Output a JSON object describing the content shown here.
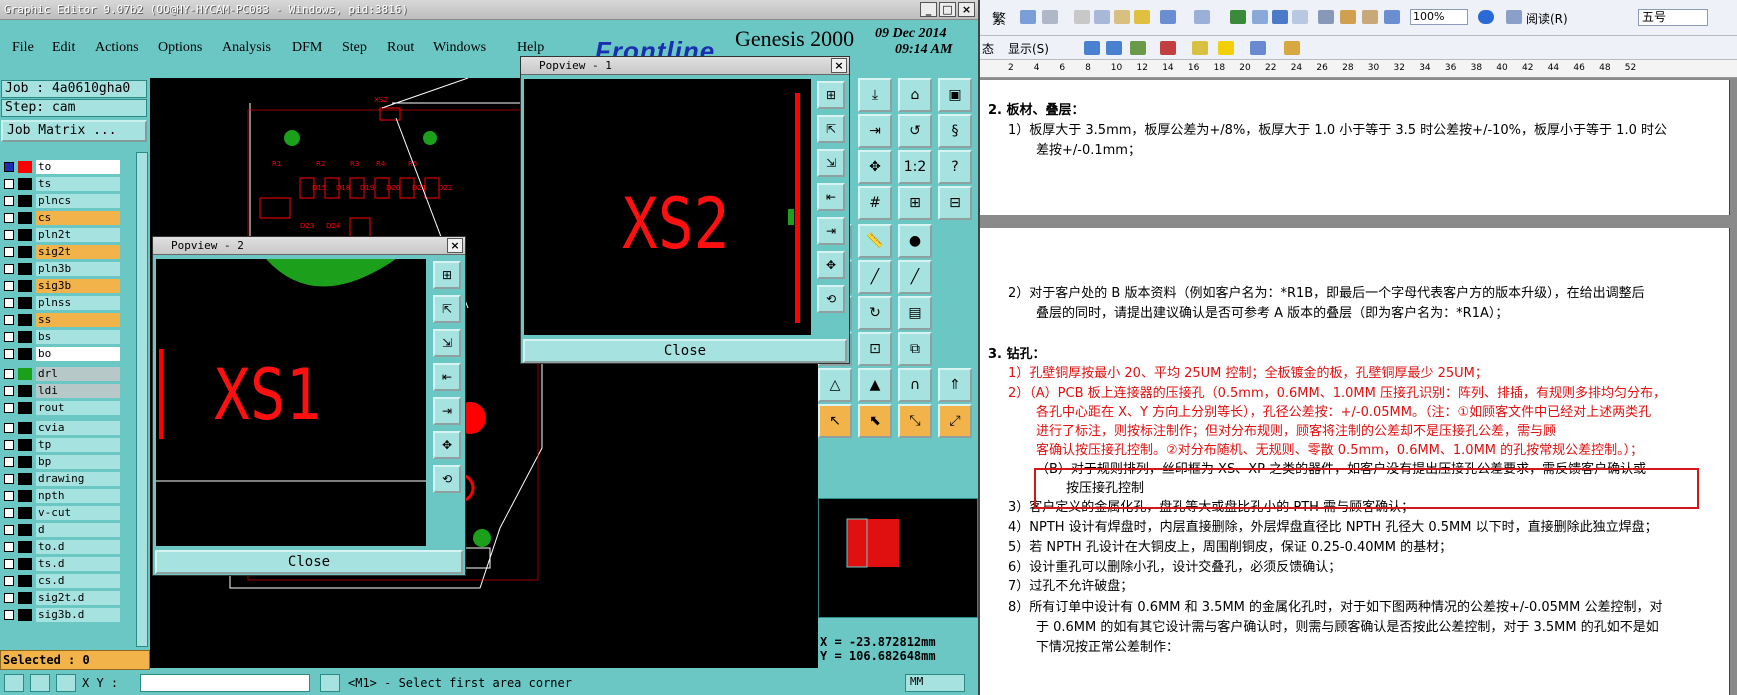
{
  "genesis": {
    "title": "Graphic Editor 9.07b2 (OO@HY-HYCAM-PC083 - Windows, pid:3816)",
    "menu": [
      "File",
      "Edit",
      "Actions",
      "Options",
      "Analysis",
      "DFM",
      "Step",
      "Rout",
      "Windows",
      "Help"
    ],
    "logo": "Frontline",
    "product": "Genesis 2000",
    "date": "09 Dec 2014",
    "time": "09:14 AM",
    "job": "Job : 4a0610gha0",
    "step": "Step: cam",
    "job_matrix": "Job Matrix ...",
    "layers": [
      {
        "name": "to",
        "style": "white"
      },
      {
        "name": "ts",
        "style": "normal"
      },
      {
        "name": "plncs",
        "style": "normal"
      },
      {
        "name": "cs",
        "style": "yellow"
      },
      {
        "name": "pln2t",
        "style": "normal"
      },
      {
        "name": "sig2t",
        "style": "yellow"
      },
      {
        "name": "pln3b",
        "style": "normal"
      },
      {
        "name": "sig3b",
        "style": "yellow"
      },
      {
        "name": "plnss",
        "style": "normal"
      },
      {
        "name": "ss",
        "style": "yellow"
      },
      {
        "name": "bs",
        "style": "normal"
      },
      {
        "name": "bo",
        "style": "white"
      },
      {
        "name": "drl",
        "style": "gray"
      },
      {
        "name": "ldi",
        "style": "gray"
      },
      {
        "name": "rout",
        "style": "normal"
      },
      {
        "name": "cvia",
        "style": "normal"
      },
      {
        "name": "tp",
        "style": "normal"
      },
      {
        "name": "bp",
        "style": "normal"
      },
      {
        "name": "drawing",
        "style": "normal"
      },
      {
        "name": "npth",
        "style": "normal"
      },
      {
        "name": "v-cut",
        "style": "normal"
      },
      {
        "name": "d",
        "style": "normal"
      },
      {
        "name": "to.d",
        "style": "normal"
      },
      {
        "name": "ts.d",
        "style": "normal"
      },
      {
        "name": "cs.d",
        "style": "normal"
      },
      {
        "name": "sig2t.d",
        "style": "normal"
      },
      {
        "name": "sig3b.d",
        "style": "normal"
      }
    ],
    "selected": "Selected : 0",
    "xy_label": "X Y :",
    "status_msg": "<M1> - Select first area corner",
    "units": "MM",
    "coord_x": "X = -23.872812mm",
    "coord_y": "Y = 106.682648mm",
    "pcb_labels": [
      "XS2",
      "XS1",
      "D15",
      "D18",
      "D19",
      "D20",
      "D21",
      "D22",
      "D23",
      "D24",
      "R1",
      "R2",
      "R3",
      "R4",
      "R5",
      "R6",
      "R7",
      "R8",
      "R9",
      "R10"
    ],
    "popview1": {
      "title": "Popview - 1",
      "text": "XS2",
      "close": "Close"
    },
    "popview2": {
      "title": "Popview - 2",
      "text": "XS1",
      "close": "Close"
    }
  },
  "word": {
    "font_size": "五号",
    "zoom": "100%",
    "read_btn": "阅读(R)",
    "display_btn": "显示(S)",
    "ruler": [
      "2",
      "4",
      "6",
      "8",
      "10",
      "12",
      "14",
      "16",
      "18",
      "20",
      "22",
      "24",
      "26",
      "28",
      "30",
      "32",
      "34",
      "36",
      "38",
      "40",
      "42",
      "44",
      "46",
      "48",
      "52"
    ],
    "lines": [
      {
        "text": "2.   板材、叠层：",
        "bold": true
      },
      {
        "text": "1）板厚大于 3.5mm，板厚公差为+/8%，板厚大于 1.0 小于等于 3.5 时公差按+/-10%，板厚小于等于 1.0 时公"
      },
      {
        "text": "差按+/-0.1mm；"
      },
      {
        "text": "2）对于客户处的 B 版本资料（例如客户名为：*R1B，即最后一个字母代表客户方的版本升级），在给出调整后"
      },
      {
        "text": "叠层的同时，请提出建议确认是否可参考 A 版本的叠层（即为客户名为：*R1A）；"
      },
      {
        "text": "3.   钻孔：",
        "bold": true
      },
      {
        "text": "1）孔壁铜厚按最小 20、平均 25UM 控制；全板镀金的板，孔壁铜厚最少 25UM；",
        "red": true
      },
      {
        "text": "2）（A）PCB 板上连接器的压接孔（0.5mm，0.6MM、1.0MM 压接孔识别：阵列、排插，有规则多排均匀分布，",
        "red": true
      },
      {
        "text": "各孔中心距在 X、Y 方向上分别等长），孔径公差按：+/-0.05MM。（注：①如顾客文件中已经对上述两类孔",
        "red": true
      },
      {
        "text": "进行了标注，则按标注制作；但对分布规则，顾客将注制的公差却不是压接孔公差，需与顾",
        "red": true
      },
      {
        "text": "客确认按压接孔控制。②对分布随机、无规则、零散 0.5mm，0.6MM、1.0MM 的孔按常规公差控制。）；",
        "red": true
      },
      {
        "text": "（B）对于规则排列，丝印框为 XS、XP 之类的器件，如客户没有提出压接孔公差要求，需反馈客户确认或"
      },
      {
        "text": "按压接孔控制"
      },
      {
        "text": "3）客户定义的金属化孔，盘孔等大或盘比孔小的 PTH 需与顾客确认；"
      },
      {
        "text": "4）NPTH 设计有焊盘时，内层直接删除，外层焊盘直径比 NPTH 孔径大 0.5MM 以下时，直接删除此独立焊盘；"
      },
      {
        "text": "5）若 NPTH 孔设计在大铜皮上，周围削铜皮，保证 0.25-0.40MM 的基材；"
      },
      {
        "text": "6）设计重孔可以删除小孔，设计交叠孔，必须反馈确认；"
      },
      {
        "text": "7）过孔不允许破盘；"
      },
      {
        "text": "8）所有订单中设计有 0.6MM 和 3.5MM 的金属化孔时，对于如下图两种情况的公差按+/-0.05MM 公差控制，对"
      },
      {
        "text": "于 0.6MM 的如有其它设计需与客户确认时，则需与顾客确认是否按此公差控制，对于 3.5MM 的孔如不是如"
      },
      {
        "text": "下情况按正常公差制作："
      }
    ]
  }
}
